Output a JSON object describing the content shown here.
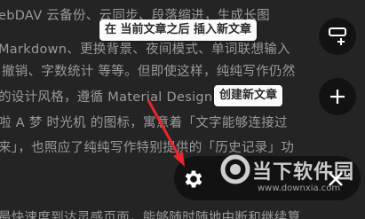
{
  "editor": {
    "lines": [
      "ebDAV 云备份、云同步、段落缩进，生成长图",
      "Markdown、更换背景、夜间模式、单词联想输入",
      "撤销、字数统计 等等。但即使这样，纯纯写作仍然",
      "的设计风格，遵循 Material Design，",
      "啦 A 梦 时光机 的图标，寓意着「文字能够连接过",
      "来」，也照应了纯纯写作特别提供的「历史记录」功",
      "",
      "最快速度到达灵感页面，能够随时随地中断和继续算"
    ]
  },
  "fab_menu": {
    "insert_after_label": "在 当前文章之后 插入新文章",
    "create_label": "创建新文章"
  },
  "watermark": {
    "brand": "当下软件园",
    "url": "www.downxia.com"
  },
  "colors": {
    "background": "#242424",
    "text": "#9a9a9a",
    "tooltip_bg": "#fafafa",
    "fab_bg": "#121212",
    "arrow": "#e8262b"
  }
}
